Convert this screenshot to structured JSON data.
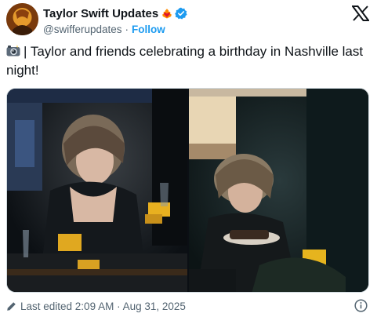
{
  "author": {
    "display_name": "Taylor Swift Updates",
    "handle": "@swifferupdates",
    "separator": "·",
    "follow_label": "Follow"
  },
  "tweet": {
    "text": "| Taylor and friends celebrating a birthday in Nashville last night!"
  },
  "footer": {
    "edited_label": "Last edited 2:09 AM · Aug 31, 2025"
  },
  "icons": {
    "emoji_heart": "heart-on-fire-icon",
    "verified": "verified-badge-icon",
    "brand": "x-logo-icon",
    "camera": "camera-flash-icon",
    "edit": "pencil-icon",
    "info": "info-icon"
  },
  "colors": {
    "text": "#0f1419",
    "secondary": "#536471",
    "link": "#1d9bf0",
    "border": "#cfd9de"
  }
}
